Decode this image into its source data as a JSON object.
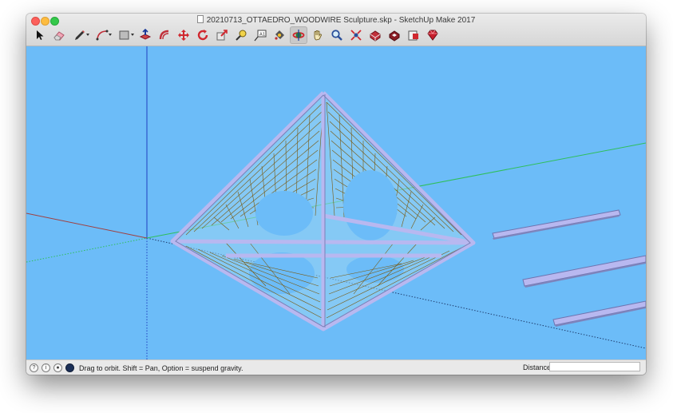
{
  "window": {
    "title": "20210713_OTTAEDRO_WOODWIRE Sculpture.skp - SketchUp Make 2017"
  },
  "toolbar": {
    "tools": [
      {
        "name": "select-tool",
        "icon": "arrow-cursor-icon"
      },
      {
        "name": "eraser-tool",
        "icon": "eraser-icon"
      },
      {
        "name": "line-tool",
        "icon": "pencil-icon",
        "dropdown": true
      },
      {
        "name": "arc-tool",
        "icon": "arc-icon",
        "dropdown": true
      },
      {
        "name": "shape-tool",
        "icon": "rectangle-icon",
        "dropdown": true
      },
      {
        "name": "push-pull-tool",
        "icon": "push-pull-icon"
      },
      {
        "name": "offset-tool",
        "icon": "offset-icon"
      },
      {
        "name": "move-tool",
        "icon": "move-icon"
      },
      {
        "name": "rotate-tool",
        "icon": "rotate-icon"
      },
      {
        "name": "scale-tool",
        "icon": "scale-icon"
      },
      {
        "name": "tape-measure-tool",
        "icon": "tape-measure-icon"
      },
      {
        "name": "text-tool",
        "icon": "text-icon"
      },
      {
        "name": "paint-bucket-tool",
        "icon": "paint-bucket-icon"
      },
      {
        "name": "orbit-tool",
        "icon": "orbit-icon",
        "active": true
      },
      {
        "name": "pan-tool",
        "icon": "hand-icon"
      },
      {
        "name": "zoom-tool",
        "icon": "magnifier-icon"
      },
      {
        "name": "zoom-extents-tool",
        "icon": "zoom-extents-icon"
      },
      {
        "name": "warehouse-tool",
        "icon": "3d-warehouse-icon"
      },
      {
        "name": "extension-warehouse-tool",
        "icon": "extension-warehouse-icon"
      },
      {
        "name": "send-to-layout-tool",
        "icon": "layout-icon"
      },
      {
        "name": "extension-manager-tool",
        "icon": "ruby-gem-icon"
      }
    ]
  },
  "colors": {
    "sky": "#6cbcf8",
    "frame": "#b8b8f0",
    "wire": "#7a5a10",
    "axis_red": "#a04040",
    "axis_green": "#2fbf5a",
    "axis_blue": "#2040c0"
  },
  "statusbar": {
    "hint": "Drag to orbit. Shift = Pan, Option = suspend gravity.",
    "distance_label": "Distance",
    "distance_value": ""
  }
}
